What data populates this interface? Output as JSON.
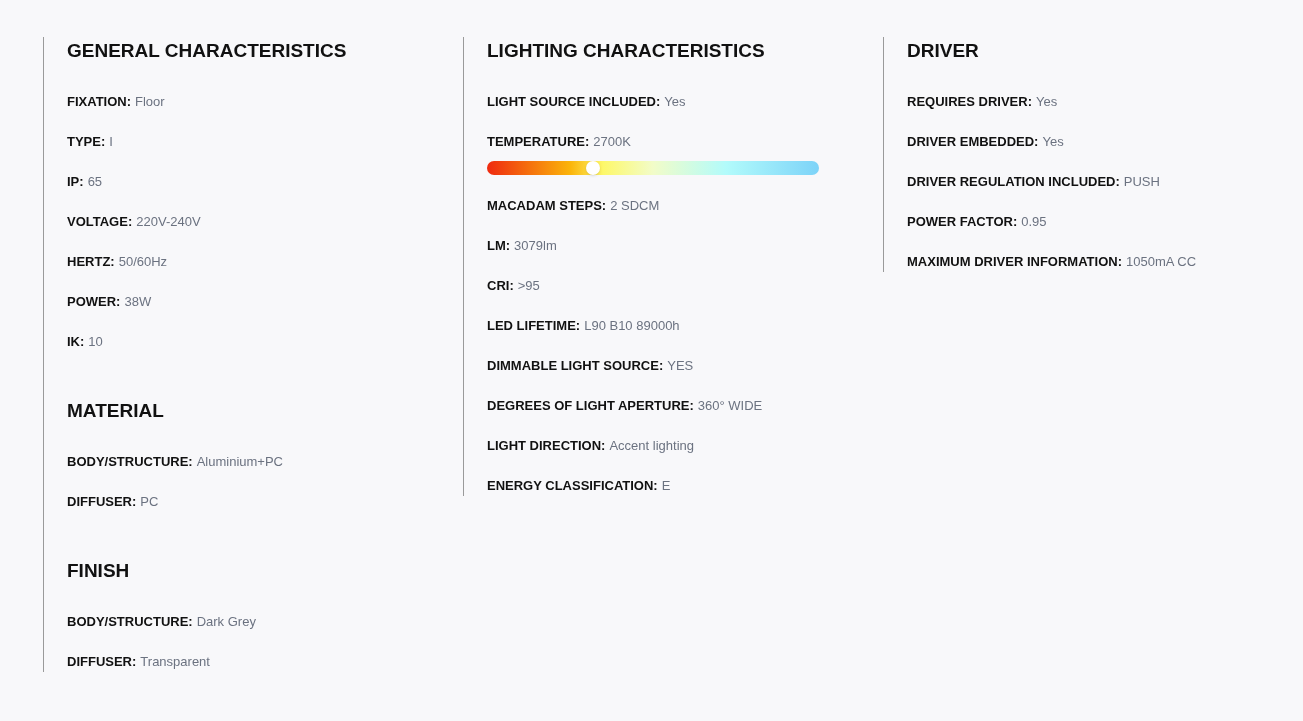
{
  "columns": [
    {
      "sections": [
        {
          "title": "GENERAL CHARACTERISTICS",
          "items": [
            {
              "kind": "spec",
              "label": "FIXATION:",
              "value": "Floor"
            },
            {
              "kind": "spec",
              "label": "TYPE:",
              "value": "I"
            },
            {
              "kind": "spec",
              "label": "IP:",
              "value": "65"
            },
            {
              "kind": "spec",
              "label": "VOLTAGE:",
              "value": "220V-240V"
            },
            {
              "kind": "spec",
              "label": "HERTZ:",
              "value": "50/60Hz"
            },
            {
              "kind": "spec",
              "label": "POWER:",
              "value": "38W"
            },
            {
              "kind": "spec",
              "label": "IK:",
              "value": "10"
            }
          ]
        },
        {
          "title": "MATERIAL",
          "items": [
            {
              "kind": "spec",
              "label": "BODY/STRUCTURE:",
              "value": "Aluminium+PC"
            },
            {
              "kind": "spec",
              "label": "DIFFUSER:",
              "value": "PC"
            }
          ]
        },
        {
          "title": "FINISH",
          "items": [
            {
              "kind": "spec",
              "label": "BODY/STRUCTURE:",
              "value": "Dark Grey"
            },
            {
              "kind": "spec",
              "label": "DIFFUSER:",
              "value": "Transparent"
            }
          ]
        }
      ]
    },
    {
      "sections": [
        {
          "title": "LIGHTING CHARACTERISTICS",
          "items": [
            {
              "kind": "spec",
              "label": "LIGHT SOURCE INCLUDED:",
              "value": "Yes"
            },
            {
              "kind": "slider",
              "label": "TEMPERATURE:",
              "value": "2700K",
              "level": 0.32
            },
            {
              "kind": "spec",
              "label": "MACADAM STEPS:",
              "value": "2 SDCM"
            },
            {
              "kind": "spec",
              "label": "LM:",
              "value": "3079lm"
            },
            {
              "kind": "spec",
              "label": "CRI:",
              "value": ">95"
            },
            {
              "kind": "spec",
              "label": "LED LIFETIME:",
              "value": "L90 B10 89000h"
            },
            {
              "kind": "spec",
              "label": "DIMMABLE LIGHT SOURCE:",
              "value": "YES"
            },
            {
              "kind": "spec",
              "label": "DEGREES OF LIGHT APERTURE:",
              "value": "360° WIDE"
            },
            {
              "kind": "spec",
              "label": "LIGHT DIRECTION:",
              "value": "Accent lighting"
            },
            {
              "kind": "spec",
              "label": "ENERGY CLASSIFICATION:",
              "value": "E"
            }
          ]
        }
      ]
    },
    {
      "sections": [
        {
          "title": "DRIVER",
          "items": [
            {
              "kind": "spec",
              "label": "REQUIRES DRIVER:",
              "value": "Yes"
            },
            {
              "kind": "spec",
              "label": "DRIVER EMBEDDED:",
              "value": "Yes"
            },
            {
              "kind": "spec",
              "label": "DRIVER REGULATION INCLUDED:",
              "value": "PUSH"
            },
            {
              "kind": "spec",
              "label": "POWER FACTOR:",
              "value": "0.95"
            },
            {
              "kind": "spec",
              "label": "MAXIMUM DRIVER INFORMATION:",
              "value": "1050mA CC"
            }
          ]
        }
      ]
    }
  ]
}
